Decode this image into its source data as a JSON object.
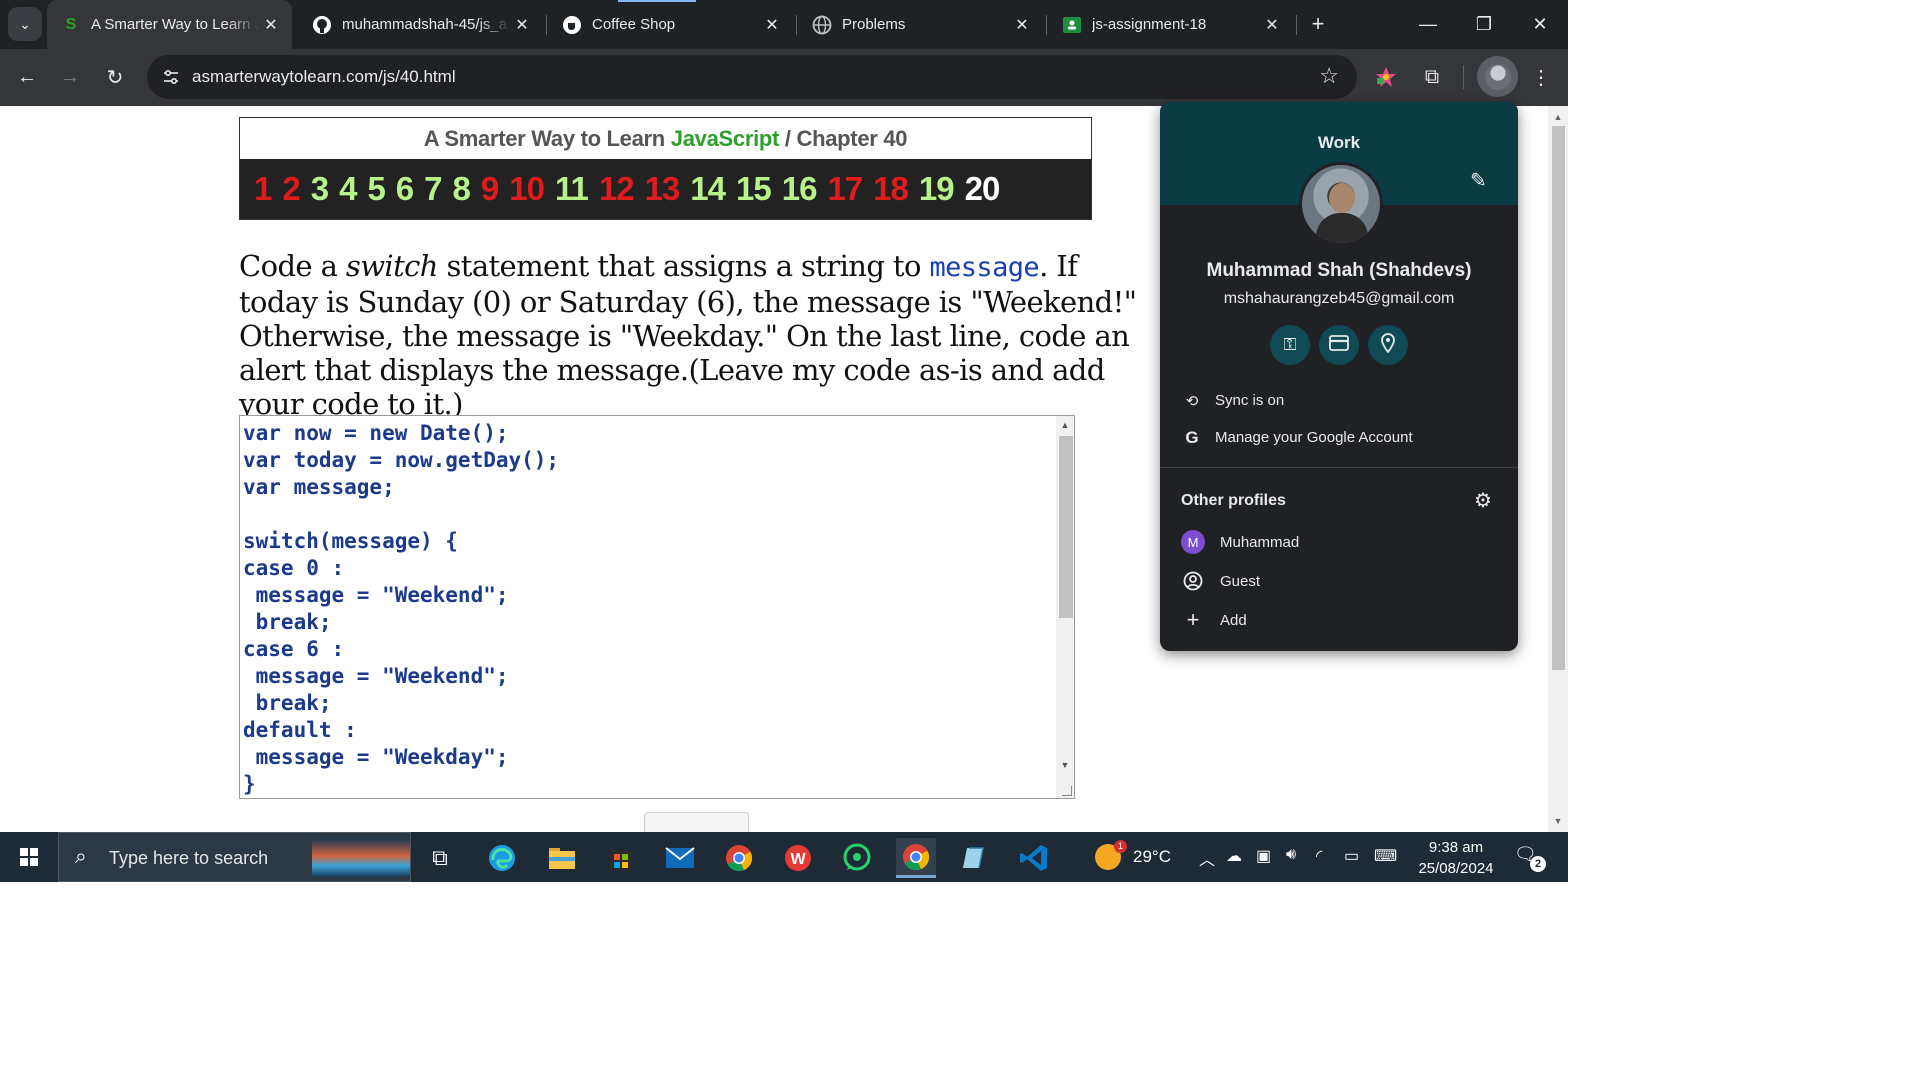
{
  "browser": {
    "tabs": [
      {
        "title": "A Smarter Way to Learn J",
        "favicon": "S",
        "active": true
      },
      {
        "title": "muhammadshah-45/js_a",
        "favicon": "github-icon",
        "active": false
      },
      {
        "title": "Coffee Shop",
        "favicon": "coffee-icon",
        "active": false
      },
      {
        "title": "Problems",
        "favicon": "globe-icon",
        "active": false
      },
      {
        "title": "js-assignment-18",
        "favicon": "classroom-icon",
        "active": false
      }
    ],
    "url": "asmarterwaytolearn.com/js/40.html"
  },
  "page": {
    "header": {
      "prefix": "A Smarter Way to Learn",
      "brand": "JavaScript",
      "separator": "/",
      "chapter": "Chapter 40"
    },
    "chapters": [
      {
        "n": "1",
        "state": "red"
      },
      {
        "n": "2",
        "state": "red"
      },
      {
        "n": "3",
        "state": "green"
      },
      {
        "n": "4",
        "state": "green"
      },
      {
        "n": "5",
        "state": "green"
      },
      {
        "n": "6",
        "state": "green"
      },
      {
        "n": "7",
        "state": "green"
      },
      {
        "n": "8",
        "state": "green"
      },
      {
        "n": "9",
        "state": "red"
      },
      {
        "n": "10",
        "state": "red"
      },
      {
        "n": "11",
        "state": "green"
      },
      {
        "n": "12",
        "state": "red"
      },
      {
        "n": "13",
        "state": "red"
      },
      {
        "n": "14",
        "state": "green"
      },
      {
        "n": "15",
        "state": "green"
      },
      {
        "n": "16",
        "state": "green"
      },
      {
        "n": "17",
        "state": "red"
      },
      {
        "n": "18",
        "state": "red"
      },
      {
        "n": "19",
        "state": "green"
      },
      {
        "n": "20",
        "state": "white"
      }
    ],
    "instructions": {
      "part1": "Code a ",
      "switch_word": "switch",
      "part2": " statement that assigns a string to ",
      "code_word": "message",
      "part3": ". If today is Sunday (0) or Saturday (6), the message is \"Weekend!\" Otherwise, the message is \"Weekday.\" On the last line, code an alert that displays the message.(Leave my code as-is and add your code to it.)"
    },
    "code": "var now = new Date();\nvar today = now.getDay();\nvar message;\n\nswitch(message) {\ncase 0 :\n message = \"Weekend\";\n break;\ncase 6 :\n message = \"Weekend\";\n break;\ndefault :\n message = \"Weekday\";\n}"
  },
  "profile_menu": {
    "profile_label": "Work",
    "name": "Muhammad Shah (Shahdevs)",
    "email": "mshahaurangzeb45@gmail.com",
    "quick_icons": [
      "key-icon",
      "card-icon",
      "location-icon"
    ],
    "sync": "Sync is on",
    "manage": "Manage your Google Account",
    "other_profiles_title": "Other profiles",
    "others": [
      {
        "label": "Muhammad",
        "icon": "M"
      },
      {
        "label": "Guest",
        "icon": "guest-icon"
      },
      {
        "label": "Add",
        "icon": "plus-icon"
      }
    ]
  },
  "taskbar": {
    "search_placeholder": "Type here to search",
    "weather_temp": "29°C",
    "weather_badge": "1",
    "time": "9:38 am",
    "date": "25/08/2024",
    "notification_count": "2"
  }
}
